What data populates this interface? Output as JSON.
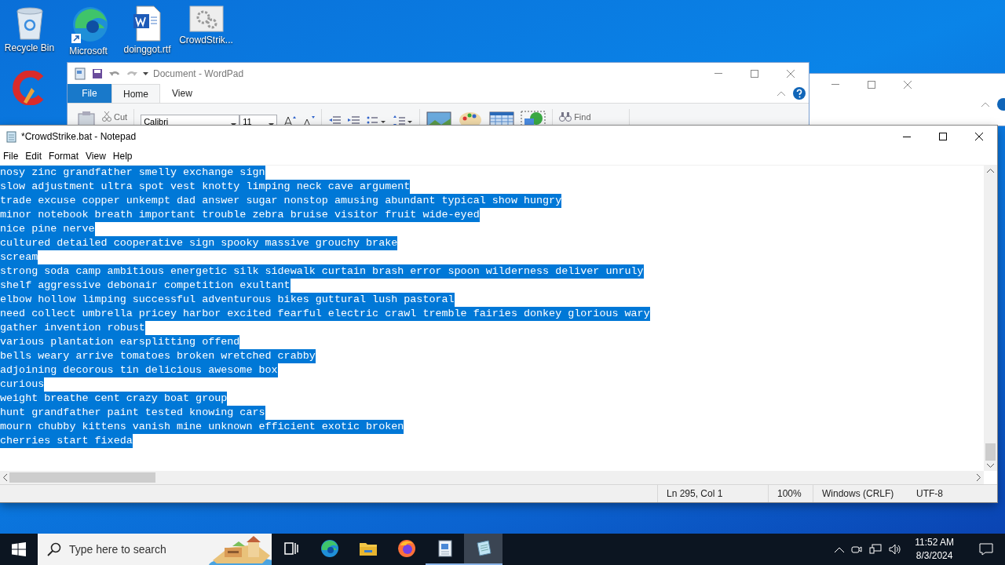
{
  "desktop_icons": [
    {
      "kind": "recycle-bin",
      "label": "Recycle Bin"
    },
    {
      "kind": "edge",
      "label": "Microsoft"
    },
    {
      "kind": "word",
      "label": "doinggot.rtf"
    },
    {
      "kind": "settings-file",
      "label": "CrowdStrik..."
    },
    {
      "kind": "cleaner"
    }
  ],
  "wordpad": {
    "title": "Document - WordPad",
    "tabs": [
      {
        "kind": "app-menu",
        "label": "File",
        "selected": false
      },
      {
        "kind": "tab",
        "label": "Home",
        "selected": true
      },
      {
        "kind": "tab",
        "label": "View",
        "selected": false
      }
    ],
    "cut_label": "Cut",
    "font_name": "Calibri",
    "font_size": "11",
    "find_label": "Find"
  },
  "notepad": {
    "title": "*CrowdStrike.bat - Notepad",
    "menu": [
      "File",
      "Edit",
      "Format",
      "View",
      "Help"
    ],
    "text_selected": true,
    "lines": [
      "nosy zinc grandfather smelly exchange sign",
      "slow adjustment ultra spot vest knotty limping neck cave argument",
      "trade excuse copper unkempt dad answer sugar nonstop amusing abundant typical show hungry",
      "minor notebook breath important trouble zebra bruise visitor fruit wide-eyed",
      "nice pine nerve",
      "cultured detailed cooperative sign spooky massive grouchy brake",
      "scream",
      "strong soda camp ambitious energetic silk sidewalk curtain brash error spoon wilderness deliver unruly",
      "shelf aggressive debonair competition exultant",
      "elbow hollow limping successful adventurous bikes guttural lush pastoral",
      "need collect umbrella pricey harbor excited fearful electric crawl tremble fairies donkey glorious wary",
      "gather invention robust",
      "various plantation earsplitting offend",
      "bells weary arrive tomatoes broken wretched crabby",
      "adjoining decorous tin delicious awesome box",
      "curious",
      "weight breathe cent crazy boat group",
      "hunt grandfather paint tested knowing cars",
      "mourn chubby kittens vanish mine unknown efficient exotic broken",
      "cherries start fixeda"
    ],
    "status": {
      "position": "Ln 295, Col 1",
      "zoom": "100%",
      "line_ending": "Windows (CRLF)",
      "encoding": "UTF-8"
    }
  },
  "taskbar": {
    "search": {
      "placeholder": "Type here to search"
    },
    "apps": [
      {
        "kind": "task-view",
        "focused": false,
        "open": false
      },
      {
        "kind": "edge",
        "focused": false,
        "open": false
      },
      {
        "kind": "folder",
        "focused": false,
        "open": false
      },
      {
        "kind": "firefox",
        "focused": false,
        "open": false
      },
      {
        "kind": "wordpad",
        "focused": false,
        "open": true
      },
      {
        "kind": "notepad",
        "focused": true,
        "open": true
      }
    ],
    "time": "11:52 AM",
    "date": "8/3/2024"
  }
}
